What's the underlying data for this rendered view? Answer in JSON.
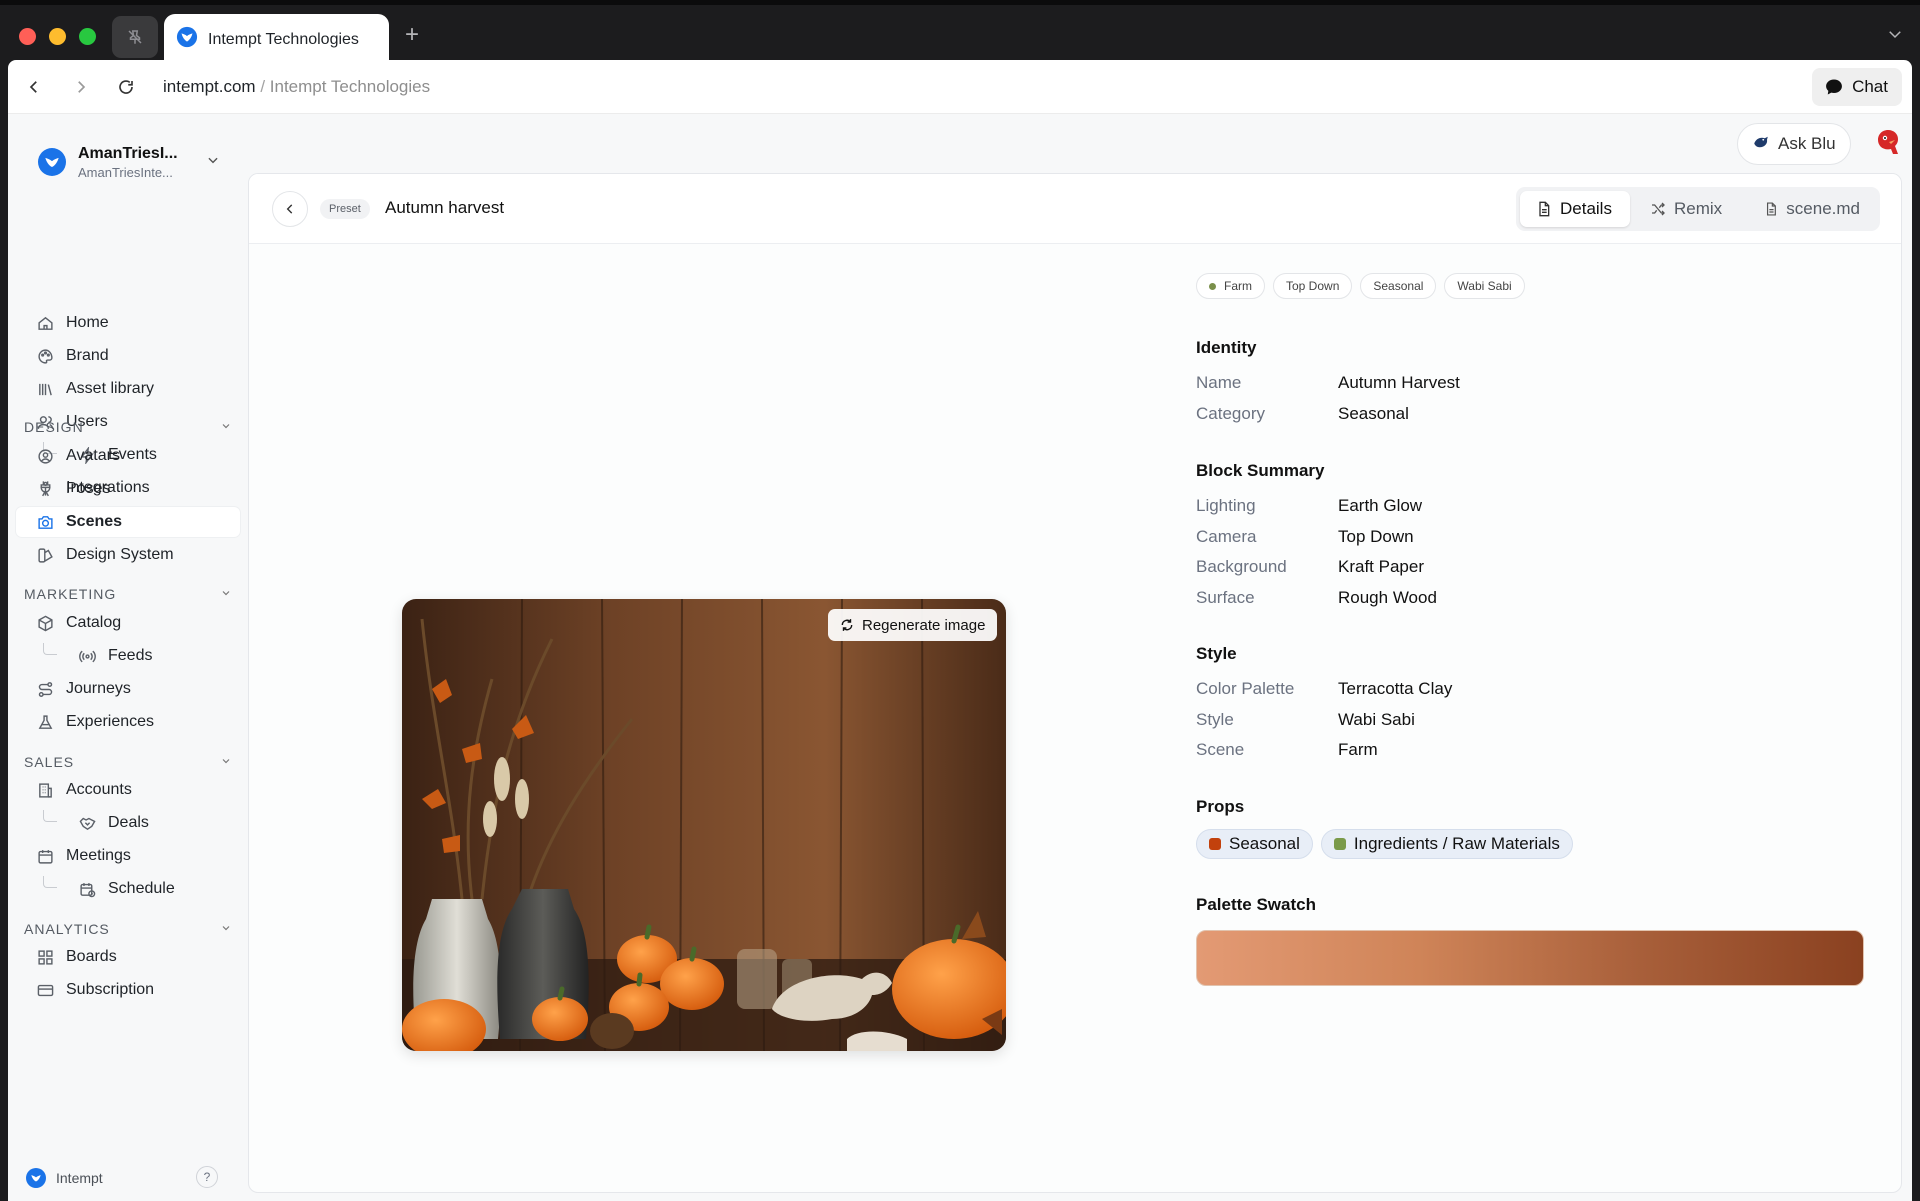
{
  "browser": {
    "tab_title": "Intempt Technologies",
    "url_domain": "intempt.com",
    "url_separator": " / ",
    "url_path": "Intempt Technologies",
    "chat_label": "Chat"
  },
  "workspace": {
    "name": "AmanTriesI...",
    "subtitle": "AmanTriesInte..."
  },
  "sidebar": {
    "items": [
      {
        "label": "Home",
        "icon": "home-icon"
      },
      {
        "label": "Brand",
        "icon": "palette-icon"
      },
      {
        "label": "Asset library",
        "icon": "library-icon"
      },
      {
        "label": "Users",
        "icon": "users-icon"
      },
      {
        "label": "Events",
        "icon": "bolt-icon"
      },
      {
        "label": "Integrations",
        "icon": "plug-icon"
      }
    ],
    "sections": {
      "design": {
        "label": "DESIGN",
        "items": [
          {
            "label": "Avatars",
            "icon": "avatar-icon"
          },
          {
            "label": "Poses",
            "icon": "pose-icon"
          },
          {
            "label": "Scenes",
            "icon": "camera-icon",
            "active": true
          },
          {
            "label": "Design System",
            "icon": "design-system-icon"
          }
        ]
      },
      "marketing": {
        "label": "MARKETING",
        "items": [
          {
            "label": "Catalog",
            "icon": "box-icon"
          },
          {
            "label": "Feeds",
            "icon": "broadcast-icon"
          },
          {
            "label": "Journeys",
            "icon": "route-icon"
          },
          {
            "label": "Experiences",
            "icon": "flask-icon"
          }
        ]
      },
      "sales": {
        "label": "SALES",
        "items": [
          {
            "label": "Accounts",
            "icon": "building-icon"
          },
          {
            "label": "Deals",
            "icon": "handshake-icon"
          },
          {
            "label": "Meetings",
            "icon": "calendar-icon"
          },
          {
            "label": "Schedule",
            "icon": "calendar-clock-icon"
          }
        ]
      },
      "analytics": {
        "label": "ANALYTICS",
        "items": [
          {
            "label": "Boards",
            "icon": "grid-icon"
          },
          {
            "label": "Subscription",
            "icon": "card-icon"
          }
        ]
      }
    },
    "footer_label": "Intempt",
    "help_label": "?"
  },
  "topbar": {
    "ask_label": "Ask Blu"
  },
  "panel": {
    "preset_badge": "Preset",
    "title": "Autumn harvest",
    "tabs": [
      {
        "label": "Details",
        "icon": "document-icon",
        "active": true
      },
      {
        "label": "Remix",
        "icon": "shuffle-icon"
      },
      {
        "label": "scene.md",
        "icon": "file-icon"
      }
    ],
    "regenerate_label": "Regenerate image"
  },
  "details": {
    "tags": [
      "Farm",
      "Top Down",
      "Seasonal",
      "Wabi Sabi"
    ],
    "identity": {
      "title": "Identity",
      "rows": [
        {
          "key": "Name",
          "value": "Autumn Harvest"
        },
        {
          "key": "Category",
          "value": "Seasonal"
        }
      ]
    },
    "block_summary": {
      "title": "Block Summary",
      "rows": [
        {
          "key": "Lighting",
          "value": "Earth Glow"
        },
        {
          "key": "Camera",
          "value": "Top Down"
        },
        {
          "key": "Background",
          "value": "Kraft Paper"
        },
        {
          "key": "Surface",
          "value": "Rough Wood"
        }
      ]
    },
    "style": {
      "title": "Style",
      "rows": [
        {
          "key": "Color Palette",
          "value": "Terracotta Clay"
        },
        {
          "key": "Style",
          "value": "Wabi Sabi"
        },
        {
          "key": "Scene",
          "value": "Farm"
        }
      ]
    },
    "props": {
      "title": "Props",
      "items": [
        {
          "label": "Seasonal",
          "color": "#c2410c"
        },
        {
          "label": "Ingredients / Raw Materials",
          "color": "#7a9a4a"
        }
      ]
    },
    "palette": {
      "title": "Palette Swatch",
      "colors": [
        "#e39a74",
        "#cf8458",
        "#a85f3a",
        "#8a4120"
      ]
    }
  },
  "colors": {
    "accent": "#1a73e8",
    "farm_dot": "#7a8f4a"
  }
}
